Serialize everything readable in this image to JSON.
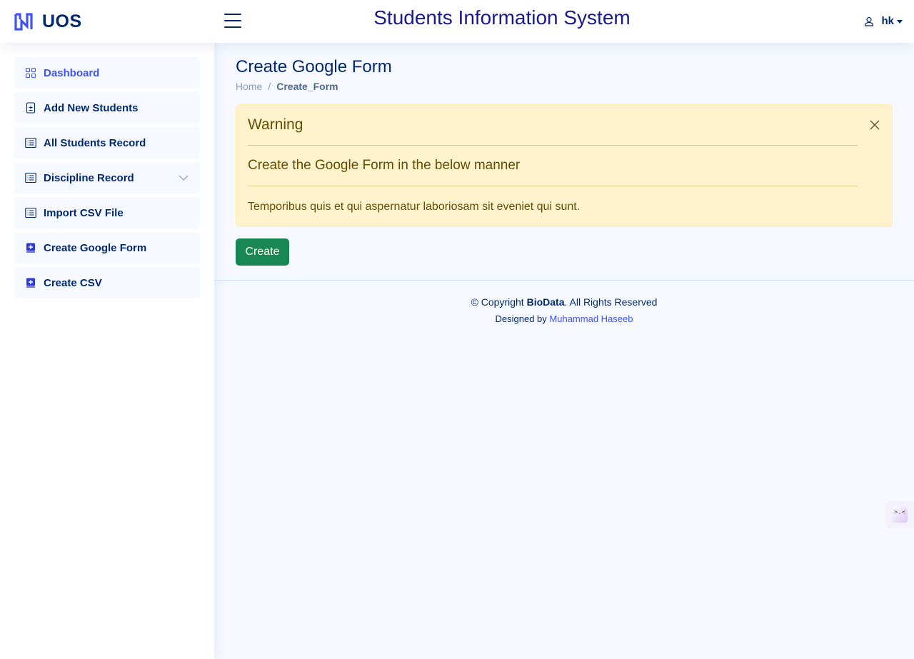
{
  "header": {
    "logo_text": "UOS",
    "site_title": "Students Information System",
    "user_name": "hk"
  },
  "sidebar": {
    "items": [
      {
        "label": "Dashboard",
        "icon": "grid-icon"
      },
      {
        "label": "Add New Students",
        "icon": "file-plus-icon"
      },
      {
        "label": "All Students Record",
        "icon": "list-icon"
      },
      {
        "label": "Discipline Record",
        "icon": "list-icon"
      },
      {
        "label": "Import CSV File",
        "icon": "list-icon"
      },
      {
        "label": "Create Google Form",
        "icon": "plus-square-icon"
      },
      {
        "label": "Create CSV",
        "icon": "plus-square-icon"
      }
    ]
  },
  "page": {
    "title": "Create Google Form",
    "breadcrumb": {
      "home": "Home",
      "separator": "/",
      "current": "Create_Form"
    }
  },
  "alert": {
    "heading": "Warning",
    "subheading": "Create the Google Form in the below manner",
    "body": "Temporibus quis et qui aspernatur laboriosam sit eveniet qui sunt."
  },
  "actions": {
    "create_label": "Create"
  },
  "footer": {
    "copyright_prefix": "© Copyright ",
    "brand": "BioData",
    "copyright_suffix": ". All Rights Reserved",
    "designed_by": "Designed by ",
    "designer": "Muhammad Haseeb"
  },
  "colors": {
    "primary": "#012970",
    "accent": "#4154f1",
    "success": "#198754",
    "warning_bg": "#fff3cd",
    "warning_text": "#664d03"
  }
}
